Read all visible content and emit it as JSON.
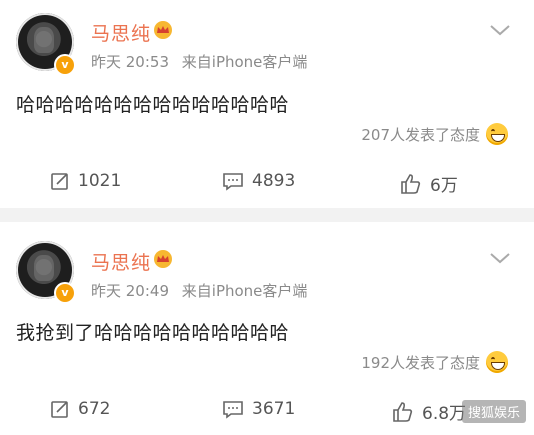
{
  "posts": [
    {
      "author": "马思纯",
      "time": "昨天 20:53",
      "source": "来自iPhone客户端",
      "text": "哈哈哈哈哈哈哈哈哈哈哈哈哈哈",
      "reactions_text": "207人发表了态度",
      "reposts": "1021",
      "comments": "4893",
      "likes": "6万"
    },
    {
      "author": "马思纯",
      "time": "昨天 20:49",
      "source": "来自iPhone客户端",
      "text": "我抢到了哈哈哈哈哈哈哈哈哈哈",
      "reactions_text": "192人发表了态度",
      "reposts": "672",
      "comments": "3671",
      "likes": "6.8万"
    }
  ],
  "watermark": "搜狐娱乐",
  "colors": {
    "name": "#eb7350",
    "vip_badge": "#f7a10a",
    "divider": "#f2f2f2"
  }
}
